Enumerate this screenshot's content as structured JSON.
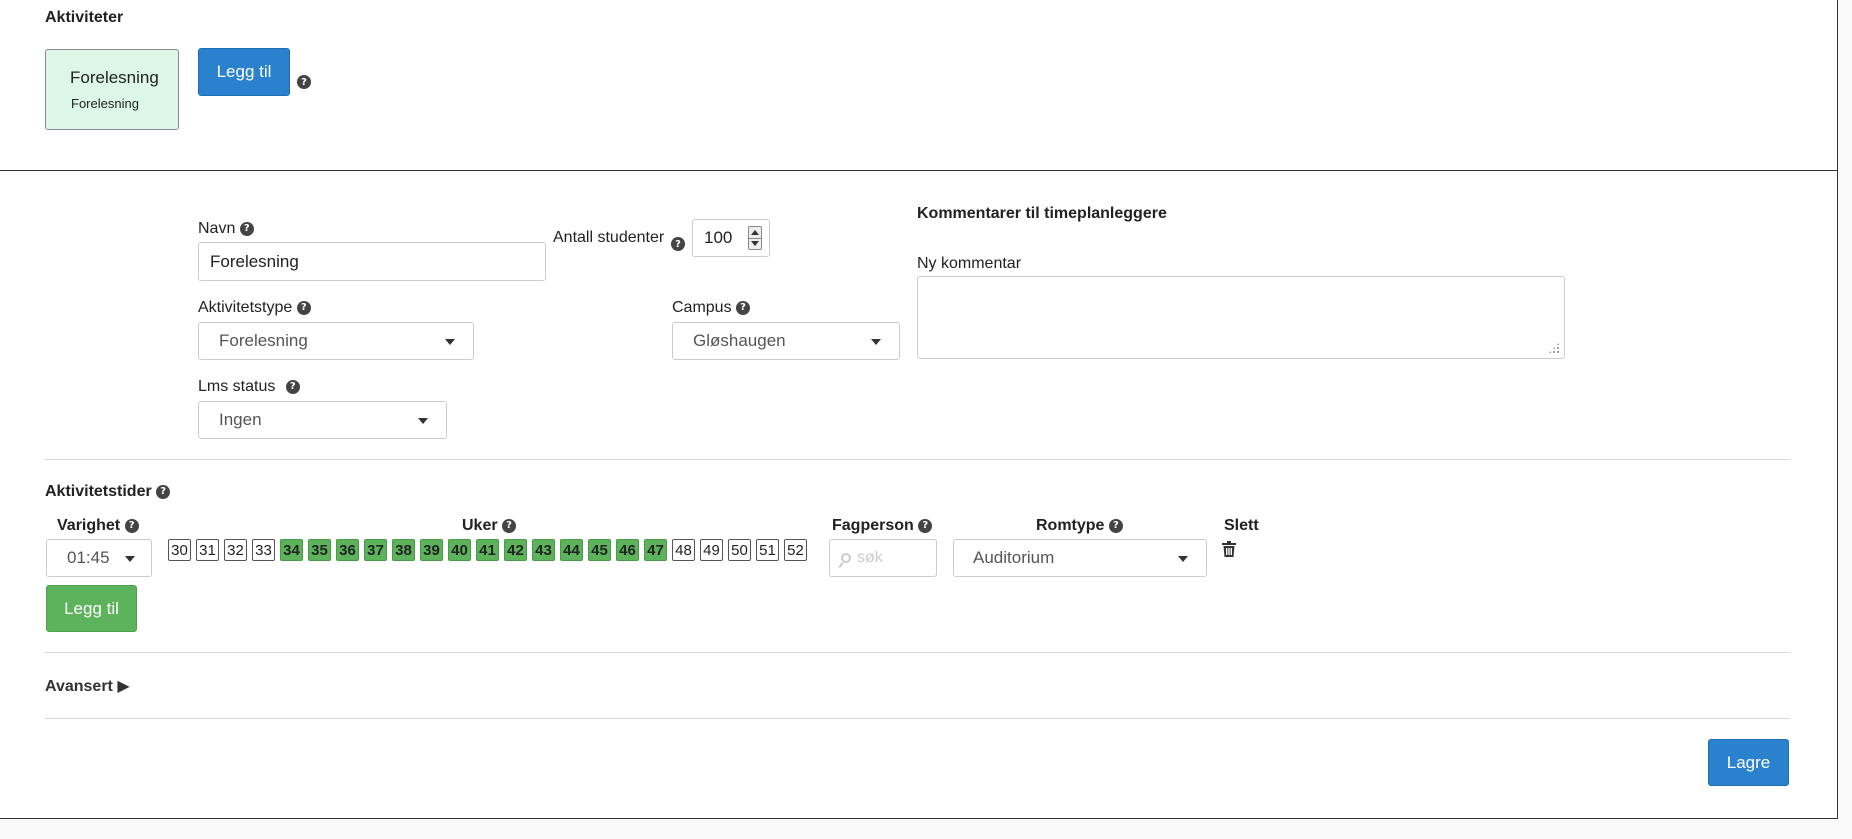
{
  "activities": {
    "heading": "Aktiviteter",
    "card": {
      "title": "Forelesning",
      "subtitle": "Forelesning"
    },
    "add_label": "Legg til"
  },
  "form": {
    "name_label": "Navn",
    "name_value": "Forelesning",
    "students_label": "Antall studenter",
    "students_value": "100",
    "type_label": "Aktivitetstype",
    "type_value": "Forelesning",
    "campus_label": "Campus",
    "campus_value": "Gløshaugen",
    "lms_label": "Lms status",
    "lms_value": "Ingen",
    "comments_heading": "Kommentarer til timeplanleggere",
    "new_comment_label": "Ny kommentar"
  },
  "times": {
    "heading": "Aktivitetstider",
    "duration_label": "Varighet",
    "duration_value": "01:45",
    "weeks_label": "Uker",
    "weeks": [
      {
        "n": "30",
        "on": false
      },
      {
        "n": "31",
        "on": false
      },
      {
        "n": "32",
        "on": false
      },
      {
        "n": "33",
        "on": false
      },
      {
        "n": "34",
        "on": true
      },
      {
        "n": "35",
        "on": true
      },
      {
        "n": "36",
        "on": true
      },
      {
        "n": "37",
        "on": true
      },
      {
        "n": "38",
        "on": true
      },
      {
        "n": "39",
        "on": true
      },
      {
        "n": "40",
        "on": true
      },
      {
        "n": "41",
        "on": true
      },
      {
        "n": "42",
        "on": true
      },
      {
        "n": "43",
        "on": true
      },
      {
        "n": "44",
        "on": true
      },
      {
        "n": "45",
        "on": true
      },
      {
        "n": "46",
        "on": true
      },
      {
        "n": "47",
        "on": true
      },
      {
        "n": "48",
        "on": false
      },
      {
        "n": "49",
        "on": false
      },
      {
        "n": "50",
        "on": false
      },
      {
        "n": "51",
        "on": false
      },
      {
        "n": "52",
        "on": false
      }
    ],
    "person_label": "Fagperson",
    "person_placeholder": "søk",
    "roomtype_label": "Romtype",
    "roomtype_value": "Auditorium",
    "delete_label": "Slett",
    "add_label": "Legg til"
  },
  "advanced_label": "Avansert ▶",
  "save_label": "Lagre",
  "colors": {
    "primary": "#2a82cf",
    "success": "#5cb35c",
    "card_bg": "#dcf7e8"
  }
}
